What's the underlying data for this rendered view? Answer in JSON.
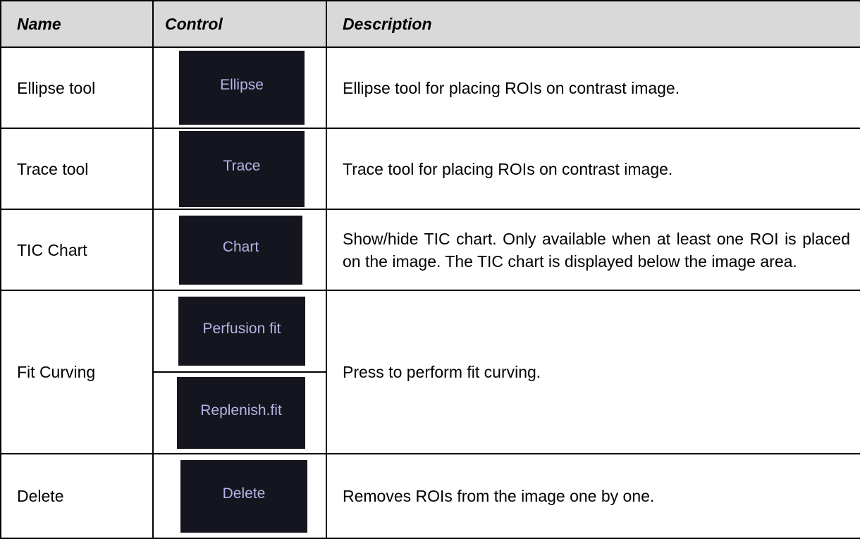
{
  "table": {
    "headers": {
      "name": "Name",
      "control": "Control",
      "description": "Description"
    },
    "rows": [
      {
        "name": "Ellipse tool",
        "controls": [
          "Ellipse"
        ],
        "description": "Ellipse tool for placing ROIs on contrast image."
      },
      {
        "name": "Trace tool",
        "controls": [
          "Trace"
        ],
        "description": "Trace tool for placing ROIs on contrast image."
      },
      {
        "name": "TIC Chart",
        "controls": [
          "Chart"
        ],
        "description": "Show/hide TIC chart. Only available when at least one ROI is placed on the image. The TIC chart is displayed below the image area."
      },
      {
        "name": "Fit Curving",
        "controls": [
          "Perfusion fit",
          "Replenish.fit"
        ],
        "description": "Press to perform fit curving."
      },
      {
        "name": "Delete",
        "controls": [
          "Delete"
        ],
        "description": "Removes ROIs from the image one by one."
      }
    ]
  },
  "colors": {
    "header_background": "#d9d9d9",
    "button_background": "#15151f",
    "button_text": "#b5b3e6",
    "border": "#000000"
  }
}
